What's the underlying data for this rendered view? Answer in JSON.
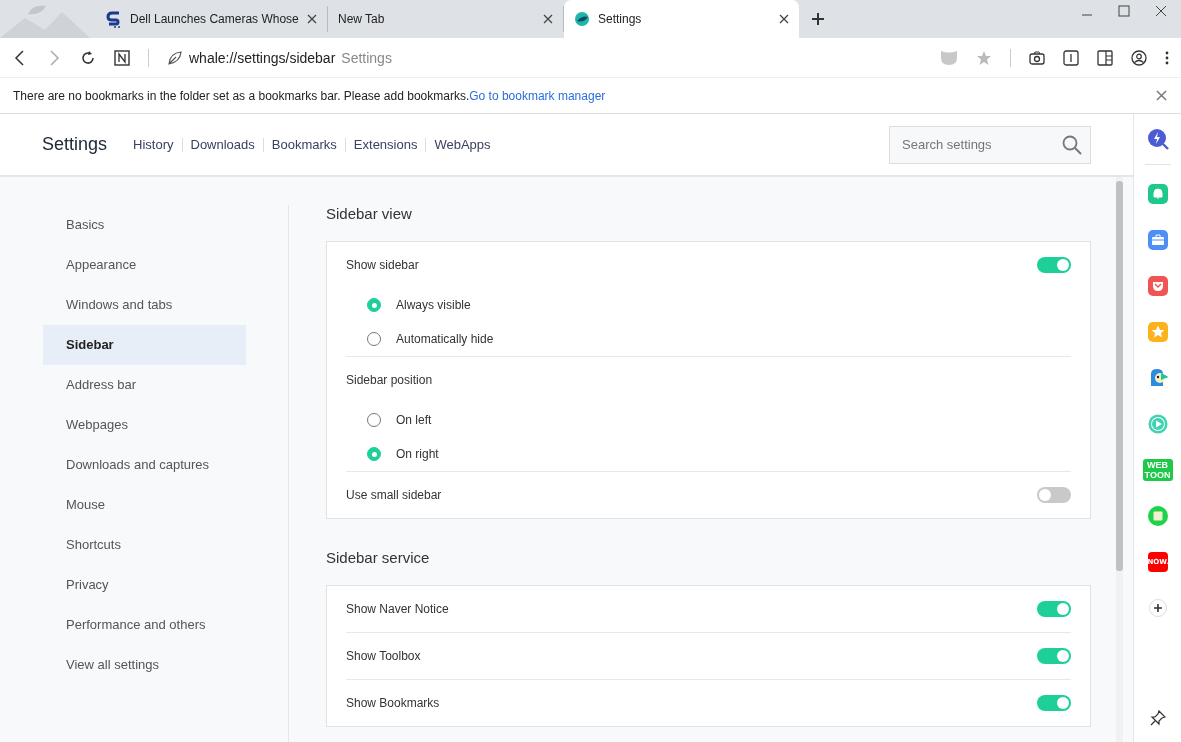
{
  "tabs": [
    {
      "title": "Dell Launches Cameras Whose",
      "kind": "site",
      "selected": false
    },
    {
      "title": "New Tab",
      "kind": "blank",
      "selected": false
    },
    {
      "title": "Settings",
      "kind": "whale",
      "selected": true
    }
  ],
  "address": {
    "url": "whale://settings/sidebar",
    "page_title": "Settings"
  },
  "bookmark_notice": {
    "text": "There are no bookmarks in the folder set as a bookmarks bar. Please add bookmarks.",
    "link": "Go to bookmark manager"
  },
  "header": {
    "title": "Settings",
    "links": [
      "History",
      "Downloads",
      "Bookmarks",
      "Extensions",
      "WebApps"
    ],
    "search_placeholder": "Search settings"
  },
  "nav": [
    {
      "label": "Basics",
      "selected": false
    },
    {
      "label": "Appearance",
      "selected": false
    },
    {
      "label": "Windows and tabs",
      "selected": false
    },
    {
      "label": "Sidebar",
      "selected": true
    },
    {
      "label": "Address bar",
      "selected": false
    },
    {
      "label": "Webpages",
      "selected": false
    },
    {
      "label": "Downloads and captures",
      "selected": false
    },
    {
      "label": "Mouse",
      "selected": false
    },
    {
      "label": "Shortcuts",
      "selected": false
    },
    {
      "label": "Privacy",
      "selected": false
    },
    {
      "label": "Performance and others",
      "selected": false
    },
    {
      "label": "View all settings",
      "selected": false
    }
  ],
  "sections": [
    {
      "title": "Sidebar view",
      "rows": [
        {
          "kind": "toggle",
          "label": "Show sidebar",
          "on": true
        },
        {
          "kind": "radio",
          "label": "Always visible",
          "selected": true
        },
        {
          "kind": "radio",
          "label": "Automatically hide",
          "selected": false
        },
        {
          "kind": "heading",
          "label": "Sidebar position"
        },
        {
          "kind": "radio",
          "label": "On left",
          "selected": false
        },
        {
          "kind": "radio",
          "label": "On right",
          "selected": true
        },
        {
          "kind": "toggle",
          "label": "Use small sidebar",
          "on": false
        }
      ]
    },
    {
      "title": "Sidebar service",
      "rows": [
        {
          "kind": "toggle",
          "label": "Show Naver Notice",
          "on": true
        },
        {
          "kind": "toggle",
          "label": "Show Toolbox",
          "on": true
        },
        {
          "kind": "toggle",
          "label": "Show Bookmarks",
          "on": true
        }
      ]
    }
  ],
  "sidebar_apps": [
    {
      "kind": "search"
    },
    {
      "kind": "bell"
    },
    {
      "kind": "briefcase"
    },
    {
      "kind": "pocket"
    },
    {
      "kind": "star"
    },
    {
      "kind": "bird"
    },
    {
      "kind": "play"
    },
    {
      "kind": "webtoon",
      "label": "WEB TOON"
    },
    {
      "kind": "square"
    },
    {
      "kind": "now",
      "label": "NOW."
    },
    {
      "kind": "add"
    }
  ]
}
